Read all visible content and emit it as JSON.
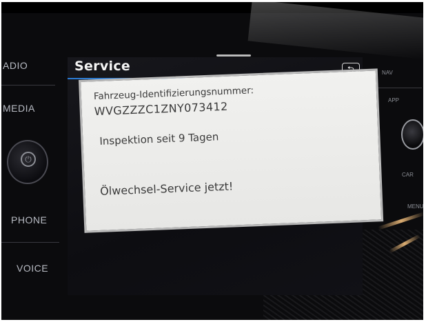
{
  "left_buttons": [
    {
      "label": "ADIO"
    },
    {
      "label": "MEDIA"
    },
    {
      "label": "PHONE"
    },
    {
      "label": "VOICE"
    }
  ],
  "right_buttons": [
    {
      "label": "NAV"
    },
    {
      "label": "APP"
    },
    {
      "label": "CAR"
    },
    {
      "label": "MENU"
    }
  ],
  "screen": {
    "title": "Service",
    "back_icon": "back-arrow-icon",
    "accent_color": "#2f80d8"
  },
  "dialog": {
    "vin_label": "Fahrzeug-Identifizierungsnummer:",
    "vin": "WVGZZZC1ZNY073412",
    "inspection": "Inspektion seit 9 Tagen",
    "oil_change": "Ölwechsel-Service jetzt!"
  }
}
